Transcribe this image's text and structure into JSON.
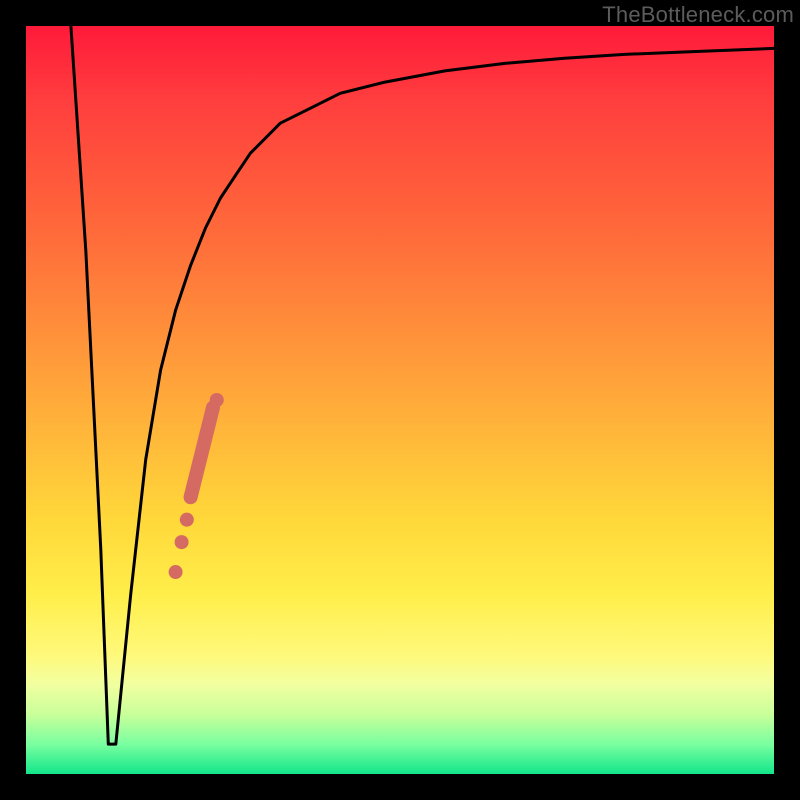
{
  "watermark": {
    "text": "TheBottleneck.com"
  },
  "chart_data": {
    "type": "line",
    "title": "",
    "xlabel": "",
    "ylabel": "",
    "xlim": [
      0,
      100
    ],
    "ylim": [
      0,
      100
    ],
    "series": [
      {
        "name": "bottleneck-curve",
        "x": [
          6,
          8,
          10,
          11,
          12,
          14,
          16,
          18,
          20,
          22,
          24,
          26,
          28,
          30,
          34,
          38,
          42,
          48,
          56,
          64,
          72,
          80,
          90,
          100
        ],
        "values": [
          100,
          70,
          30,
          4,
          4,
          24,
          42,
          54,
          62,
          68,
          73,
          77,
          80,
          83,
          87,
          89,
          91,
          92.5,
          94,
          95,
          95.7,
          96.2,
          96.6,
          97
        ]
      }
    ],
    "highlight": {
      "name": "selected-range",
      "points": [
        {
          "x": 20.0,
          "value": 27
        },
        {
          "x": 20.8,
          "value": 31
        },
        {
          "x": 21.5,
          "value": 34
        },
        {
          "x": 25.5,
          "value": 50
        }
      ],
      "bar": {
        "x_start": 22.0,
        "y_start": 37,
        "x_end": 25.0,
        "y_end": 49
      }
    },
    "gradient_stops": [
      {
        "pos": 0,
        "color": "#ff1a3a"
      },
      {
        "pos": 10,
        "color": "#ff3e3e"
      },
      {
        "pos": 28,
        "color": "#ff6b3a"
      },
      {
        "pos": 42,
        "color": "#ff933a"
      },
      {
        "pos": 55,
        "color": "#ffb83a"
      },
      {
        "pos": 66,
        "color": "#ffd83a"
      },
      {
        "pos": 76,
        "color": "#ffee4a"
      },
      {
        "pos": 84,
        "color": "#fff97a"
      },
      {
        "pos": 88,
        "color": "#f2ffa0"
      },
      {
        "pos": 92,
        "color": "#c9ff9a"
      },
      {
        "pos": 96,
        "color": "#7affa0"
      },
      {
        "pos": 100,
        "color": "#12e68a"
      }
    ],
    "colors": {
      "curve": "#000000",
      "highlight": "#d46a62",
      "frame": "#000000"
    }
  }
}
